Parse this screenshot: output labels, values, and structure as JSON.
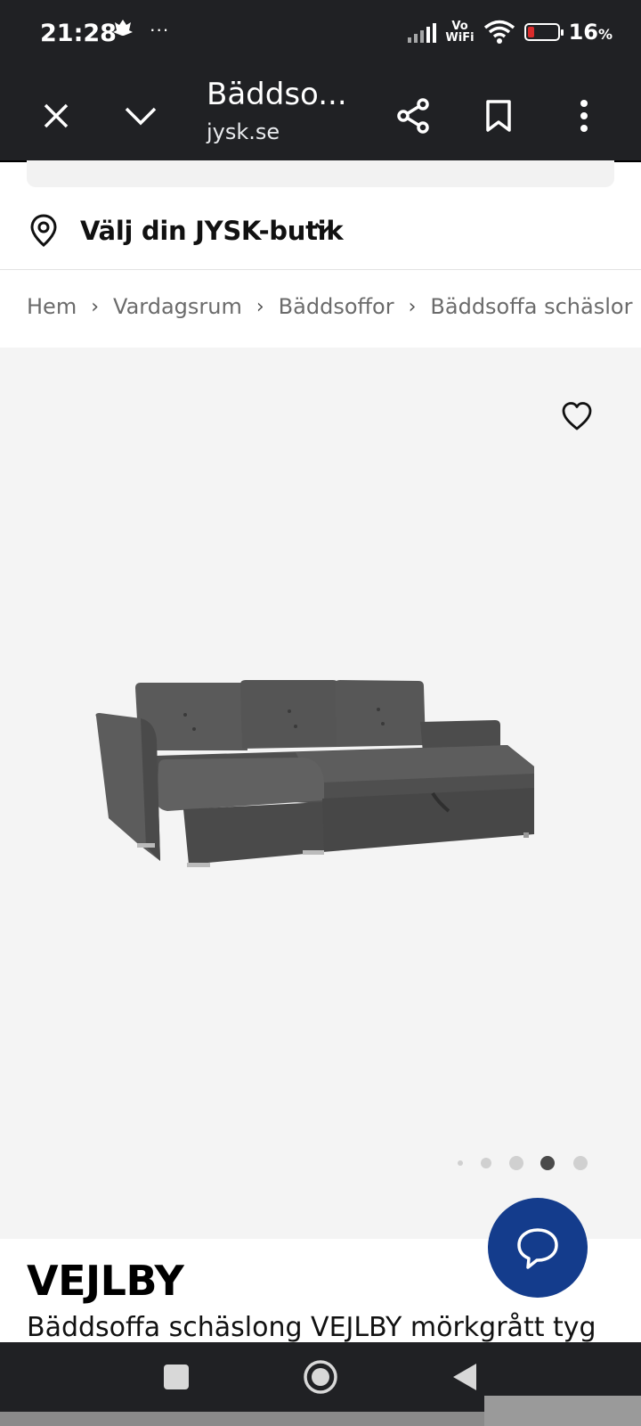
{
  "status": {
    "time": "21:28",
    "vowifi_top": "Vo",
    "vowifi_bottom": "WiFi",
    "battery": "16",
    "battery_unit": "%"
  },
  "toolbar": {
    "title": "Bäddso...",
    "domain": "jysk.se"
  },
  "store": {
    "label": "Välj din JYSK-butik"
  },
  "breadcrumb": [
    "Hem",
    "Vardagsrum",
    "Bäddsoffor",
    "Bäddsoffa schäslor"
  ],
  "gallery": {
    "image_count": 5,
    "active_index": 3
  },
  "product": {
    "title": "VEJLBY",
    "subtitle": "Bäddsoffa schäslong VEJLBY mörkgrått tyg"
  },
  "colors": {
    "chat": "#143c8c",
    "bar": "#202124",
    "image_bg": "#f4f4f4"
  }
}
